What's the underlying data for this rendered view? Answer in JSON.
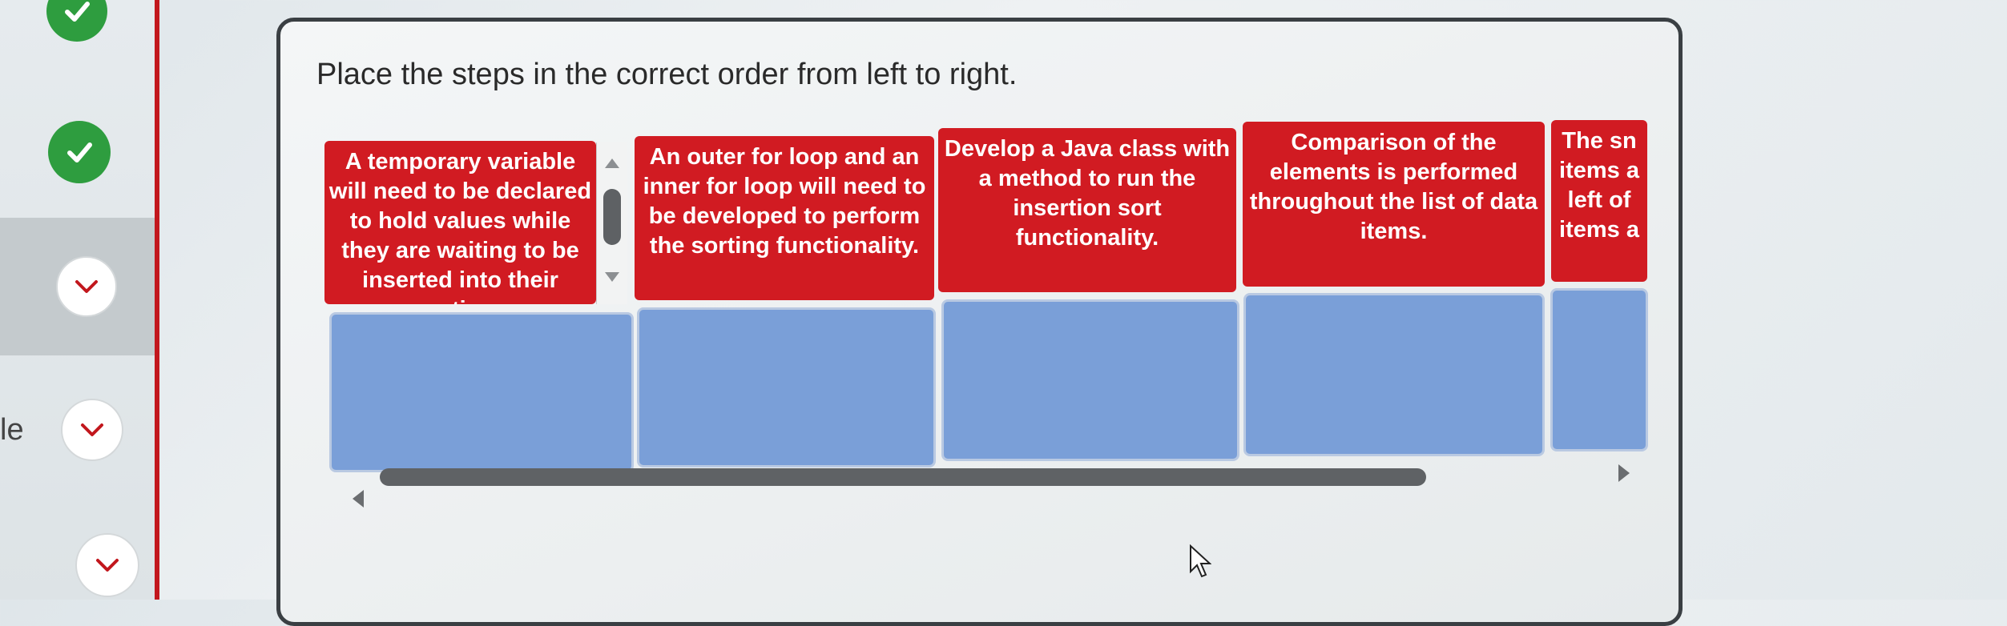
{
  "prompt": "Place the steps in the correct order from left to right.",
  "sidebar": {
    "partial_label": "le",
    "items": [
      {
        "status": "complete",
        "icon": "checkmark-icon"
      },
      {
        "status": "complete",
        "icon": "checkmark-icon"
      },
      {
        "status": "current",
        "icon": "chevron-down-icon"
      },
      {
        "status": "pending",
        "icon": "chevron-down-icon"
      },
      {
        "status": "pending",
        "icon": "chevron-down-icon"
      }
    ]
  },
  "steps": [
    {
      "text": "A temporary variable will need to be declared to hold values while they are waiting to be inserted into their respective new"
    },
    {
      "text": "An outer for loop and an inner for loop will need to be developed to perform the sorting functionality."
    },
    {
      "text": "Develop a Java class with a method to run the insertion sort functionality."
    },
    {
      "text": "Comparison of the elements is performed throughout the list of data items."
    },
    {
      "text": "The sn items a left of items a"
    }
  ],
  "colors": {
    "card": "#d11b22",
    "slot": "#7a9fd8",
    "check": "#2e9d3f",
    "accent_line": "#c2171d"
  }
}
